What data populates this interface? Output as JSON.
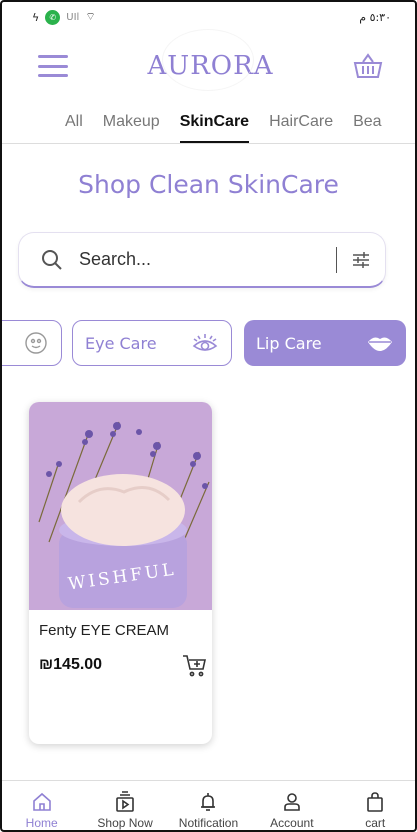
{
  "status_bar": {
    "time": "٥:٣٠ م",
    "network": "UIl"
  },
  "header": {
    "logo": "AURORA"
  },
  "tabs": [
    {
      "label": "All"
    },
    {
      "label": "Makeup"
    },
    {
      "label": "SkinCare",
      "active": true
    },
    {
      "label": "HairCare"
    },
    {
      "label": "Bea"
    }
  ],
  "page_title": "Shop Clean SkinCare",
  "search": {
    "placeholder": "Search..."
  },
  "chips": [
    {
      "label": "Eye Care",
      "icon": "eye-icon"
    },
    {
      "label": "Lip Care",
      "icon": "lips-icon",
      "selected": true
    }
  ],
  "products": [
    {
      "name": "Fenty EYE CREAM",
      "price": "₪145.00",
      "image_text": "WISHFUL"
    }
  ],
  "bottom_nav": [
    {
      "label": "Home",
      "icon": "home-icon",
      "active": true
    },
    {
      "label": "Shop Now",
      "icon": "shop-icon"
    },
    {
      "label": "Notification",
      "icon": "bell-icon"
    },
    {
      "label": "Account",
      "icon": "user-icon"
    },
    {
      "label": "cart",
      "icon": "cart-icon"
    }
  ],
  "colors": {
    "accent": "#9a8ad6",
    "text": "#222222"
  }
}
